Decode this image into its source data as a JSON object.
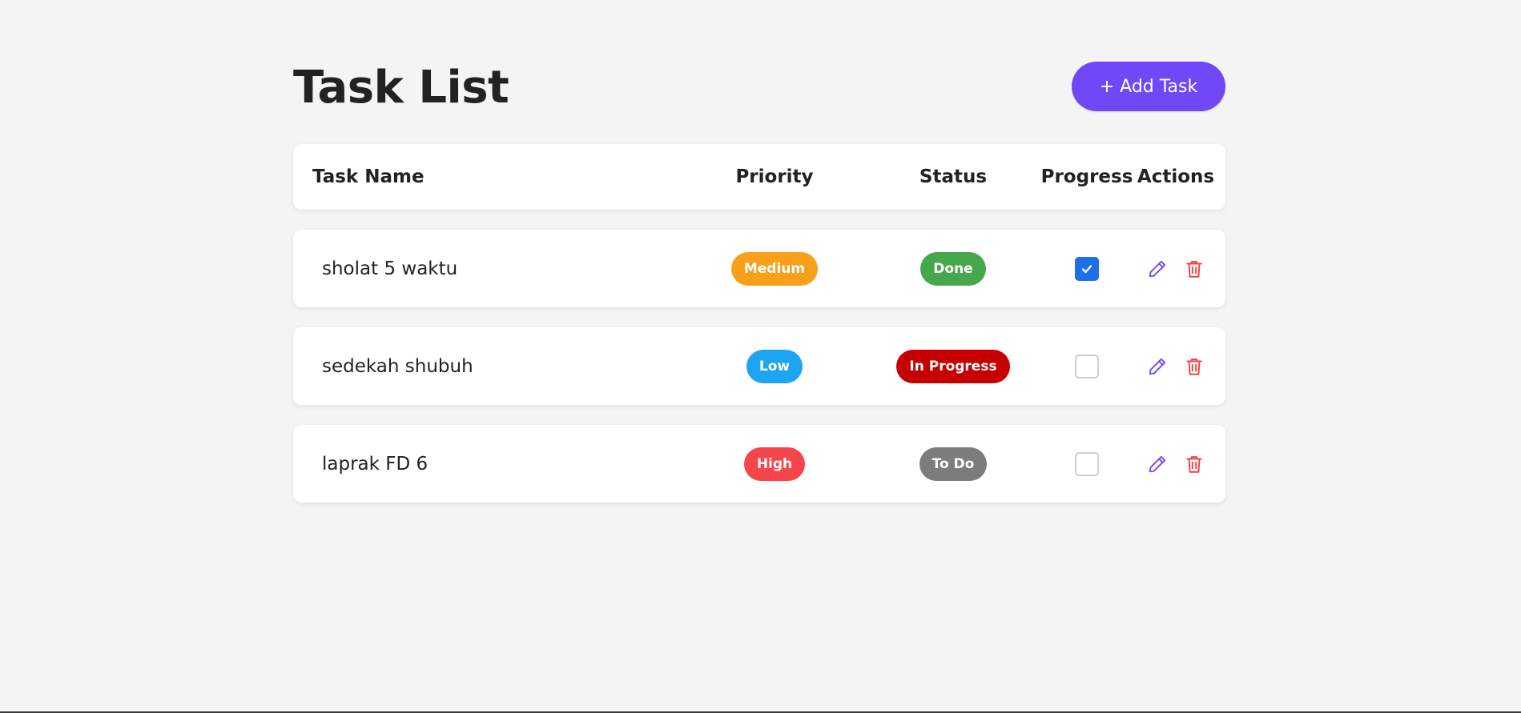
{
  "header": {
    "title": "Task List",
    "add_button_label": "+ Add Task"
  },
  "table": {
    "columns": [
      "Task Name",
      "Priority",
      "Status",
      "Progress",
      "Actions"
    ],
    "rows": [
      {
        "name": "sholat 5 waktu",
        "priority": "Medium",
        "priority_color": "#f9a01b",
        "status": "Done",
        "status_color": "#46a84a",
        "progress_checked": true,
        "actions": [
          "edit-icon",
          "delete-icon"
        ]
      },
      {
        "name": "sedekah shubuh",
        "priority": "Low",
        "priority_color": "#1ea5f2",
        "status": "In Progress",
        "status_color": "#c60000",
        "progress_checked": false,
        "actions": [
          "edit-icon",
          "delete-icon"
        ]
      },
      {
        "name": "laprak FD 6",
        "priority": "High",
        "priority_color": "#f5454b",
        "status": "To Do",
        "status_color": "#7c7c7c",
        "progress_checked": false,
        "actions": [
          "edit-icon",
          "delete-icon"
        ]
      }
    ]
  },
  "colors": {
    "accent": "#7048f5",
    "edit_icon": "#7b4cf3",
    "delete_icon": "#ef4444",
    "checkbox_checked": "#1f6fe8",
    "background": "#f4f4f4"
  }
}
